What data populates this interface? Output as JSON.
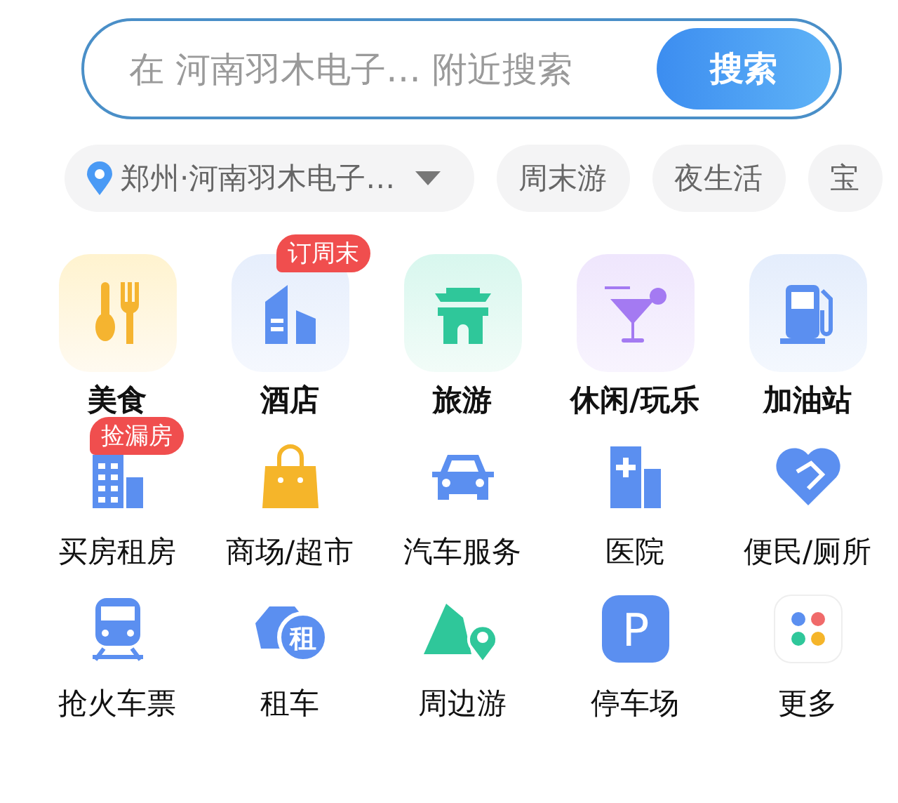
{
  "search": {
    "placeholder": "在 河南羽木电子… 附近搜索",
    "button": "搜索"
  },
  "chips": [
    {
      "kind": "location",
      "label": "郑州·河南羽木电子…"
    },
    {
      "kind": "tag",
      "label": "周末游"
    },
    {
      "kind": "tag",
      "label": "夜生活"
    },
    {
      "kind": "tag",
      "label": "宝"
    }
  ],
  "rows": [
    {
      "kind": "tiled",
      "items": [
        {
          "label": "美食"
        },
        {
          "label": "酒店",
          "badge": "订周末"
        },
        {
          "label": "旅游"
        },
        {
          "label": "休闲/玩乐"
        },
        {
          "label": "加油站"
        }
      ]
    },
    {
      "kind": "plain",
      "items": [
        {
          "label": "买房租房",
          "badge": "捡漏房"
        },
        {
          "label": "商场/超市"
        },
        {
          "label": "汽车服务"
        },
        {
          "label": "医院"
        },
        {
          "label": "便民/厕所"
        }
      ]
    },
    {
      "kind": "plain",
      "items": [
        {
          "label": "抢火车票"
        },
        {
          "label": "租车",
          "glyph": "租"
        },
        {
          "label": "周边游"
        },
        {
          "label": "停车场",
          "glyph": "P"
        },
        {
          "label": "更多"
        }
      ]
    }
  ]
}
